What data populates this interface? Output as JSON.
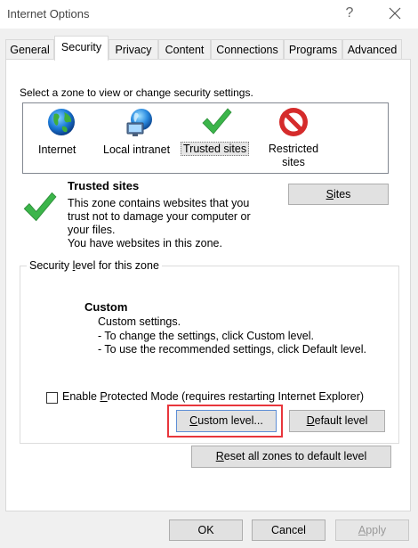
{
  "window": {
    "title": "Internet Options",
    "help_glyph": "?"
  },
  "tabs": [
    {
      "label": "General"
    },
    {
      "label": "Security",
      "active": true
    },
    {
      "label": "Privacy"
    },
    {
      "label": "Content"
    },
    {
      "label": "Connections"
    },
    {
      "label": "Programs"
    },
    {
      "label": "Advanced"
    }
  ],
  "security": {
    "zone_prompt": "Select a zone to view or change security settings.",
    "zones": [
      {
        "label": "Internet",
        "icon": "globe-icon"
      },
      {
        "label": "Local intranet",
        "icon": "intranet-globe-icon"
      },
      {
        "label": "Trusted sites",
        "icon": "green-check-icon",
        "selected": true
      },
      {
        "label_line1": "Restricted",
        "label_line2": "sites",
        "icon": "restricted-icon"
      }
    ],
    "selected_zone": {
      "title": "Trusted sites",
      "description_lines": [
        "This zone contains websites that you",
        "trust not to damage your computer or",
        "your files.",
        "You have websites in this zone."
      ]
    },
    "sites_button": {
      "prefix": "",
      "accel": "S",
      "rest": "ites"
    },
    "level_group_label": {
      "prefix": "Security ",
      "accel": "l",
      "rest": "evel for this zone"
    },
    "level": {
      "name": "Custom",
      "lines": [
        "Custom settings.",
        "- To change the settings, click Custom level.",
        "- To use the recommended settings, click Default level."
      ]
    },
    "protected_mode": {
      "prefix": "Enable ",
      "accel": "P",
      "rest": "rotected Mode (requires restarting Internet Explorer)",
      "checked": false
    },
    "custom_level_button": {
      "prefix": "",
      "accel": "C",
      "rest": "ustom level..."
    },
    "default_level_button": {
      "prefix": "",
      "accel": "D",
      "rest": "efault level"
    },
    "reset_button": {
      "prefix": "",
      "accel": "R",
      "rest": "eset all zones to default level"
    }
  },
  "footer": {
    "ok": "OK",
    "cancel": "Cancel",
    "apply_prefix": "",
    "apply_accel": "A",
    "apply_rest": "pply"
  },
  "colors": {
    "highlight_border": "#e8363c",
    "trusted_check": "#3bb54a",
    "restricted_red": "#d52b2b"
  }
}
